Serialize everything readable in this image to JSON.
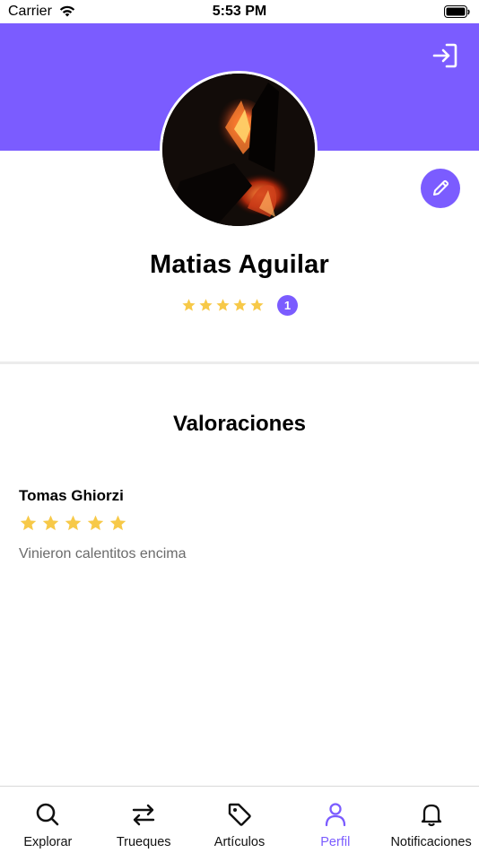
{
  "status_bar": {
    "carrier": "Carrier",
    "time": "5:53 PM"
  },
  "colors": {
    "accent": "#7b5cff",
    "star": "#f7c948",
    "tab_inactive": "#111111"
  },
  "header": {
    "logout_icon": "logout-icon"
  },
  "profile": {
    "name": "Matias Aguilar",
    "rating_stars": 5,
    "rating_count": "1",
    "edit_icon": "pencil-icon"
  },
  "reviews": {
    "title": "Valoraciones",
    "items": [
      {
        "author": "Tomas Ghiorzi",
        "stars": 5,
        "comment": "Vinieron calentitos encima"
      }
    ]
  },
  "tab_bar": {
    "tabs": [
      {
        "label": "Explorar",
        "icon": "search-icon",
        "active": false
      },
      {
        "label": "Trueques",
        "icon": "swap-icon",
        "active": false
      },
      {
        "label": "Artículos",
        "icon": "tag-icon",
        "active": false
      },
      {
        "label": "Perfil",
        "icon": "user-icon",
        "active": true
      },
      {
        "label": "Notificaciones",
        "icon": "bell-icon",
        "active": false
      }
    ]
  }
}
